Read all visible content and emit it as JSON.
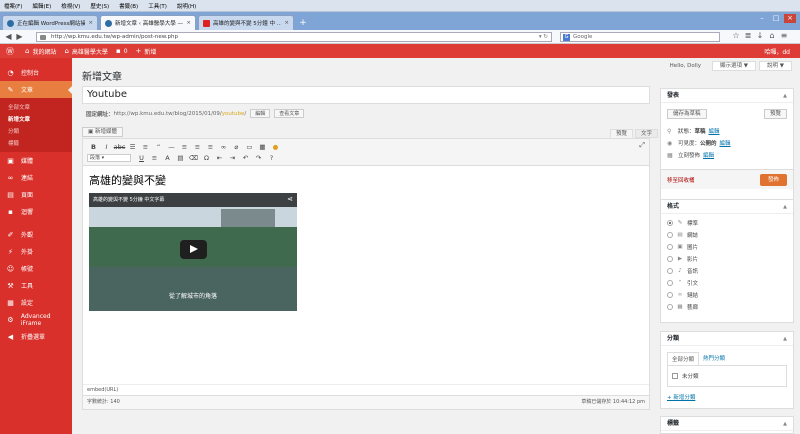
{
  "browser": {
    "menu": [
      "檔案(F)",
      "編輯(E)",
      "檢視(V)",
      "歷史(S)",
      "書籤(B)",
      "工具(T)",
      "說明(H)"
    ],
    "tabs": [
      {
        "title": "正在編輯 WordPress網站操作 (一...",
        "active": false
      },
      {
        "title": "新增文章 ‹ 高雄醫學大學 — 新...",
        "active": true
      },
      {
        "title": "高雄的變與不變 5分鐘 中 ...",
        "active": false
      }
    ],
    "url": "http://wp.kmu.edu.tw/wp-admin/post-new.php",
    "search_placeholder": "Google",
    "search_engine_letter": "G"
  },
  "adminbar": {
    "site": "我的網站",
    "site2": "高雄醫學大學",
    "comments_count": "0",
    "new_label": "新增",
    "greeting": "哈囉，dd"
  },
  "sidebar": {
    "items": [
      {
        "label": "控制台",
        "icon": "dashboard-icon"
      },
      {
        "label": "文章",
        "icon": "pin-icon",
        "current": true
      },
      {
        "label": "媒體",
        "icon": "media-icon"
      },
      {
        "label": "連結",
        "icon": "link-icon"
      },
      {
        "label": "頁面",
        "icon": "page-icon"
      },
      {
        "label": "迴響",
        "icon": "comment-icon"
      },
      {
        "label": "外觀",
        "icon": "brush-icon"
      },
      {
        "label": "外掛",
        "icon": "plugin-icon"
      },
      {
        "label": "帳號",
        "icon": "user-icon"
      },
      {
        "label": "工具",
        "icon": "wrench-icon"
      },
      {
        "label": "設定",
        "icon": "settings-icon"
      },
      {
        "label": "Advanced iFrame",
        "icon": "gear-icon"
      },
      {
        "label": "折疊選單",
        "icon": "collapse-icon"
      }
    ],
    "submenu": [
      "全部文章",
      "新增文章",
      "分類",
      "標籤"
    ]
  },
  "main": {
    "hello": "Hello, Dolly",
    "screen_options": "顯示選項 ▼",
    "help": "說明 ▼",
    "page_title": "新增文章",
    "post_title": "Youtube",
    "permalink_label": "固定網址：",
    "permalink_base": "http://wp.kmu.edu.tw/blog/2015/01/09/",
    "permalink_slug": "youtube",
    "edit_btn": "編輯",
    "view_btn": "查看文章",
    "add_media": "新增媒體",
    "tab_visual": "預覽",
    "tab_text": "文字",
    "format_select": "段落",
    "content_heading": "高雄的變與不變",
    "video_title": "高雄的變與不變 5分鐘 中文字幕",
    "video_subtitle": "從了解城市的角落",
    "path": "embed(URL)",
    "word_count": "字數統計: 140",
    "draft_saved": "草稿已儲存於 10:44:12 pm"
  },
  "publish_box": {
    "title": "發表",
    "save_draft": "儲存為草稿",
    "preview": "預覽",
    "status_label": "狀態：",
    "status_value": "草稿",
    "status_edit": "編輯",
    "visibility_label": "可見度：",
    "visibility_value": "公開的",
    "visibility_edit": "編輯",
    "schedule_label": "立刻發佈",
    "schedule_edit": "編輯",
    "trash": "移至回收桶",
    "publish": "發佈"
  },
  "format_box": {
    "title": "格式",
    "options": [
      "標準",
      "網誌",
      "圖片",
      "影片",
      "音訊",
      "引文",
      "鏈結",
      "藝廊"
    ]
  },
  "category_box": {
    "title": "分類",
    "tab_all": "全部分類",
    "tab_popular": "熱門分類",
    "uncategorized": "未分類",
    "add_new": "+ 新增分類"
  },
  "tags_box": {
    "title": "標籤"
  }
}
